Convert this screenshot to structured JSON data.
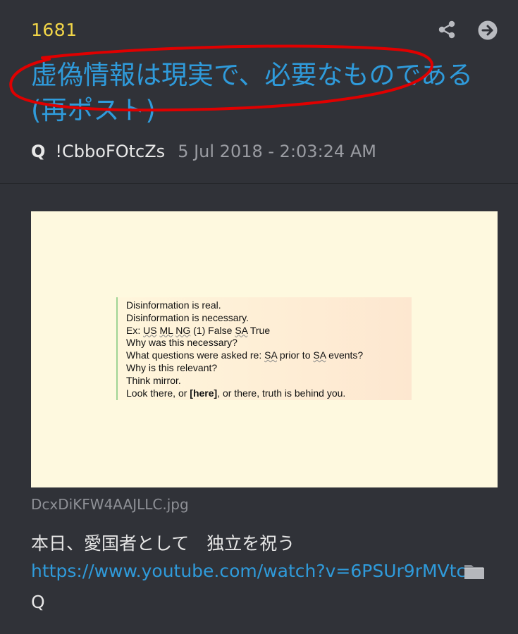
{
  "post": {
    "number": "1681",
    "title": "虚偽情報は現実で、必要なものである(再ポスト)",
    "author": "Q",
    "tripcode": "!CbboFOtcZs",
    "timestamp": "5 Jul 2018 - 2:03:24 AM",
    "icons": {
      "share": "share-icon",
      "goto": "arrow-right-circle-icon",
      "folder": "folder-icon"
    },
    "attachment": {
      "filename": "DcxDiKFW4AAJLLC.jpg",
      "image_text": {
        "line1": "Disinformation is real.",
        "line2": "Disinformation is necessary.",
        "line3_prefix": "Ex: ",
        "line3_us": "US",
        "line3_ml": "ML",
        "line3_ng": "NG",
        "line3_mid": " (1) False ",
        "line3_sa": "SA",
        "line3_suffix": " True",
        "line4": "Why was this necessary?",
        "line5_prefix": "What questions were asked re: ",
        "line5_sa1": "SA",
        "line5_mid": " prior to ",
        "line5_sa2": "SA",
        "line5_suffix": " events?",
        "line6": "Why is this relevant?",
        "line7": "Think mirror.",
        "line8_prefix": "Look there, or ",
        "line8_bold": "[here]",
        "line8_suffix": ", or there, truth is behind you."
      }
    },
    "body": "本日、愛国者として　独立を祝う",
    "link": "https://www.youtube.com/watch?v=6PSUr9rMVtc",
    "signature": "Q",
    "colors": {
      "background": "#303238",
      "post_number": "#f2d648",
      "title_link": "#2f9bdb",
      "annotation": "#e00000"
    }
  }
}
